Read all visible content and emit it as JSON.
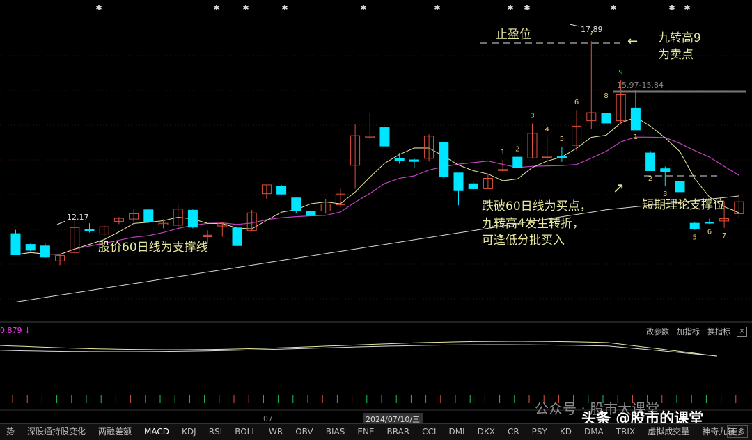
{
  "chart_data": {
    "type": "candlestick",
    "price_range": [
      11.0,
      18.6
    ],
    "candles": [
      {
        "o": 12.88,
        "h": 12.98,
        "l": 12.32,
        "c": 12.33
      },
      {
        "o": 12.6,
        "h": 12.62,
        "l": 12.42,
        "c": 12.45
      },
      {
        "o": 12.56,
        "h": 12.62,
        "l": 12.25,
        "c": 12.27
      },
      {
        "o": 12.17,
        "h": 12.36,
        "l": 12.06,
        "c": 12.31
      },
      {
        "o": 12.39,
        "h": 13.25,
        "l": 12.36,
        "c": 13.04
      },
      {
        "o": 12.99,
        "h": 13.15,
        "l": 12.91,
        "c": 12.95
      },
      {
        "o": 12.87,
        "h": 13.11,
        "l": 12.82,
        "c": 13.06
      },
      {
        "o": 13.2,
        "h": 13.31,
        "l": 13.13,
        "c": 13.28
      },
      {
        "o": 13.26,
        "h": 13.51,
        "l": 13.18,
        "c": 13.4
      },
      {
        "o": 13.5,
        "h": 13.51,
        "l": 13.16,
        "c": 13.19
      },
      {
        "o": 13.11,
        "h": 13.25,
        "l": 13.02,
        "c": 13.15
      },
      {
        "o": 13.1,
        "h": 13.63,
        "l": 13.05,
        "c": 13.52
      },
      {
        "o": 13.49,
        "h": 13.51,
        "l": 13.02,
        "c": 13.05
      },
      {
        "o": 12.8,
        "h": 12.97,
        "l": 12.62,
        "c": 12.84
      },
      {
        "o": 13.08,
        "h": 13.18,
        "l": 12.8,
        "c": 13.15
      },
      {
        "o": 13.03,
        "h": 13.05,
        "l": 12.54,
        "c": 12.57
      },
      {
        "o": 12.96,
        "h": 13.5,
        "l": 12.94,
        "c": 13.42
      },
      {
        "o": 13.92,
        "h": 14.15,
        "l": 13.77,
        "c": 14.15
      },
      {
        "o": 14.11,
        "h": 14.15,
        "l": 13.87,
        "c": 13.91
      },
      {
        "o": 13.81,
        "h": 13.81,
        "l": 13.42,
        "c": 13.47
      },
      {
        "o": 13.47,
        "h": 13.47,
        "l": 13.33,
        "c": 13.35
      },
      {
        "o": 13.47,
        "h": 13.78,
        "l": 13.4,
        "c": 13.65
      },
      {
        "o": 13.63,
        "h": 14.05,
        "l": 13.58,
        "c": 13.91
      },
      {
        "o": 14.66,
        "h": 15.74,
        "l": 14.05,
        "c": 15.43
      },
      {
        "o": 15.41,
        "h": 16.02,
        "l": 15.33,
        "c": 15.42
      },
      {
        "o": 15.64,
        "h": 15.65,
        "l": 15.16,
        "c": 15.16
      },
      {
        "o": 14.84,
        "h": 14.98,
        "l": 14.7,
        "c": 14.78
      },
      {
        "o": 14.8,
        "h": 14.85,
        "l": 14.6,
        "c": 14.76
      },
      {
        "o": 14.84,
        "h": 15.46,
        "l": 14.76,
        "c": 15.42
      },
      {
        "o": 15.25,
        "h": 15.26,
        "l": 14.31,
        "c": 14.37
      },
      {
        "o": 14.46,
        "h": 14.46,
        "l": 13.62,
        "c": 14.0
      },
      {
        "o": 14.18,
        "h": 14.24,
        "l": 14.01,
        "c": 14.05
      },
      {
        "o": 14.05,
        "h": 14.43,
        "l": 14.04,
        "c": 14.32
      },
      {
        "o": 14.54,
        "h": 14.8,
        "l": 14.5,
        "c": 14.55
      },
      {
        "o": 14.87,
        "h": 14.88,
        "l": 14.58,
        "c": 14.6
      },
      {
        "o": 14.85,
        "h": 15.75,
        "l": 14.84,
        "c": 15.49
      },
      {
        "o": 14.88,
        "h": 15.4,
        "l": 14.68,
        "c": 14.89
      },
      {
        "o": 14.88,
        "h": 15.14,
        "l": 14.75,
        "c": 14.85
      },
      {
        "o": 15.18,
        "h": 16.1,
        "l": 15.04,
        "c": 15.68
      },
      {
        "o": 15.82,
        "h": 17.89,
        "l": 15.61,
        "c": 16.03
      },
      {
        "o": 16.02,
        "h": 16.27,
        "l": 15.8,
        "c": 15.76
      },
      {
        "o": 15.82,
        "h": 16.88,
        "l": 15.72,
        "c": 16.51
      },
      {
        "o": 16.15,
        "h": 16.63,
        "l": 15.6,
        "c": 15.58
      },
      {
        "o": 14.98,
        "h": 15.03,
        "l": 14.51,
        "c": 14.52
      },
      {
        "o": 14.57,
        "h": 14.63,
        "l": 14.11,
        "c": 14.5
      },
      {
        "o": 14.24,
        "h": 14.24,
        "l": 13.88,
        "c": 13.97
      },
      {
        "o": 13.15,
        "h": 13.17,
        "l": 12.98,
        "c": 13.01
      },
      {
        "o": 13.18,
        "h": 13.27,
        "l": 13.13,
        "c": 13.16
      },
      {
        "o": 13.21,
        "h": 13.72,
        "l": 13.03,
        "c": 13.27
      },
      {
        "o": 13.4,
        "h": 13.87,
        "l": 13.28,
        "c": 13.71
      }
    ],
    "ma_short_label": "15.97",
    "ma_long_label": "15.84",
    "low_label": "12.17",
    "high_label": "17.89",
    "td_sell_counts": [
      "1",
      "2",
      "3",
      "4",
      "5",
      "6",
      "7",
      "8",
      "9"
    ],
    "td_buy_counts": [
      "1",
      "2",
      "3",
      "4",
      "5",
      "6",
      "7"
    ]
  },
  "annotations": {
    "take_profit": "止盈位",
    "nine_high_line1": "九转高9",
    "nine_high_line2": "为卖点",
    "support_60": "股价60日线为支撑线",
    "break_line1": "跌破60日线为买点，",
    "break_line2": "九转高4发生转折，",
    "break_line3": "可逢低分批买入",
    "short_support": "短期理论支撑位",
    "arrow_left": "←",
    "arrow_up_right": "↗"
  },
  "macd_panel": {
    "value_label": "0.879 ↓",
    "buttons": [
      "改参数",
      "加指标",
      "换指标"
    ],
    "close": "×"
  },
  "axis": {
    "month": "07",
    "cursor_date": "2024/07/10/三"
  },
  "tabs": [
    "势",
    "深股通持股变化",
    "两融差额",
    "MACD",
    "KDJ",
    "RSI",
    "BOLL",
    "WR",
    "OBV",
    "BIAS",
    "ENE",
    "BRAR",
    "CCI",
    "DMI",
    "DKX",
    "CR",
    "PSY",
    "KD",
    "DMA",
    "TRIX",
    "虚拟成交量",
    "神奇九转"
  ],
  "active_tab": "MACD",
  "more_label": "更多",
  "watermark": {
    "gray": "公众号 · 股市大课堂",
    "white": "头条 @股市的课堂"
  },
  "colors": {
    "up": "#e05040",
    "down": "#00e5ff",
    "ma_short": "#e6e6a0",
    "ma_mid": "#c040c0",
    "ma_long": "#d8d8d8",
    "annotation": "#e8e8a0"
  }
}
